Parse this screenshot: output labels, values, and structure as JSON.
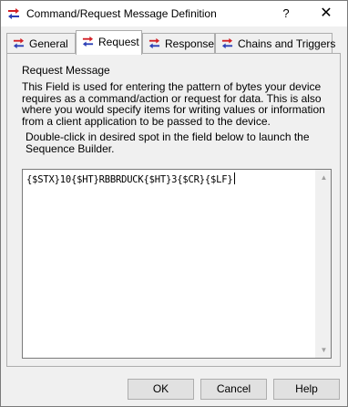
{
  "window": {
    "title": "Command/Request Message Definition",
    "help_glyph": "?",
    "close_glyph": "✕"
  },
  "tabs": [
    {
      "label": "General",
      "icon": "arrows-icon",
      "active": false
    },
    {
      "label": "Request",
      "icon": "arrows-icon",
      "active": true
    },
    {
      "label": "Response",
      "icon": "arrows-icon",
      "active": false
    },
    {
      "label": "Chains and Triggers",
      "icon": "arrows-icon",
      "active": false
    }
  ],
  "request": {
    "section_label": "Request Message",
    "description": "This Field is used for entering the pattern of bytes your device requires as a command/action or request for data.  This is also where you would specify items for writing values or information from a client application to be passed to the device.",
    "hint": "Double-click in desired spot in the field below to launch the Sequence Builder.",
    "message_value": "{$STX}10{$HT}RBBRDUCK{$HT}3{$CR}{$LF}"
  },
  "buttons": {
    "ok": "OK",
    "cancel": "Cancel",
    "help": "Help"
  },
  "colors": {
    "icon_red": "#d21f26",
    "icon_blue": "#2b3fb5"
  }
}
